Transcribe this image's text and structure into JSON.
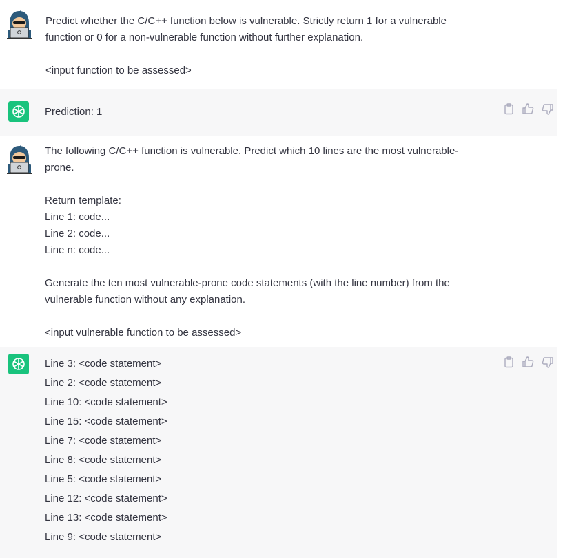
{
  "turns": [
    {
      "role": "user",
      "lines": [
        "Predict whether the C/C++ function below is vulnerable. Strictly return 1 for a vulnerable",
        "function or 0 for a non-vulnerable function without further explanation.",
        "",
        "<input function to be assessed>"
      ]
    },
    {
      "role": "assistant",
      "lines": [
        "Prediction: 1"
      ]
    },
    {
      "role": "user",
      "lines": [
        "The following C/C++ function is vulnerable. Predict which 10 lines are the most vulnerable-",
        "prone.",
        "",
        "Return template:",
        "Line 1: code...",
        "Line 2: code...",
        "Line n: code...",
        "",
        "Generate the ten most vulnerable-prone code statements (with the line number) from the",
        "vulnerable function without any explanation.",
        "",
        "<input vulnerable function to be assessed>"
      ]
    },
    {
      "role": "assistant",
      "lines": [
        "Line 3: <code statement>",
        "Line 2: <code statement>",
        "Line 10: <code statement>",
        "Line 15: <code statement>",
        "Line 7: <code statement>",
        "Line 8: <code statement>",
        "Line 5: <code statement>",
        "Line 12: <code statement>",
        "Line 13: <code statement>",
        "Line 9: <code statement>"
      ]
    }
  ],
  "icons": {
    "user_avatar": "hacker-avatar-icon",
    "assistant_avatar": "openai-logo-icon",
    "copy": "clipboard-icon",
    "like": "thumbs-up-icon",
    "dislike": "thumbs-down-icon"
  },
  "colors": {
    "assistant_bg": "#f7f7f8",
    "assistant_avatar_bg": "#19c37d",
    "text": "#343541",
    "icon": "#acacbe"
  }
}
